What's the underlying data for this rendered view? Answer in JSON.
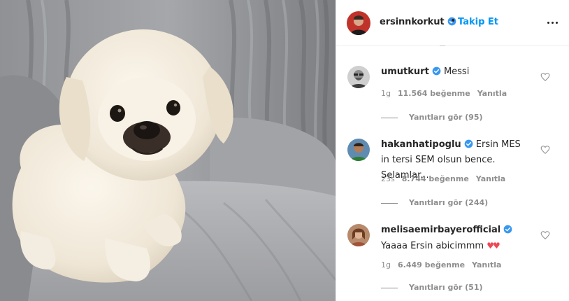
{
  "post": {
    "image_subject": "white-pekingese-dog-photo",
    "author": "ersinnkorkut",
    "follow_label": "Takip Et",
    "separator": "•"
  },
  "comments": [
    {
      "user": "umutkurt",
      "text": "Messi",
      "time": "1g",
      "likes": "11.564 beğenme",
      "reply_label": "Yanıtla",
      "view_replies": "Yanıtları gör (95)"
    },
    {
      "user": "hakanhatipoglu",
      "text": "Ersin MES in tersi SEM olsun bence. Selamlar...",
      "time": "23s",
      "likes": "8.744 beğenme",
      "reply_label": "Yanıtla",
      "view_replies": "Yanıtları gör (244)"
    },
    {
      "user": "melisaemirbayerofficial",
      "text": "Yaaaa Ersin abicimmm",
      "emoji": "♥♥",
      "time": "1g",
      "likes": "6.449 beğenme",
      "reply_label": "Yanıtla",
      "view_replies": "Yanıtları gör (51)"
    }
  ],
  "colors": {
    "follow_blue": "#0095f6",
    "verified_blue": "#3897f0",
    "muted_text": "#8e8e8e",
    "heart_red": "#ed4956"
  },
  "icons": {
    "verified": "verified-badge-icon",
    "more": "more-options-icon",
    "like": "heart-outline-icon"
  }
}
